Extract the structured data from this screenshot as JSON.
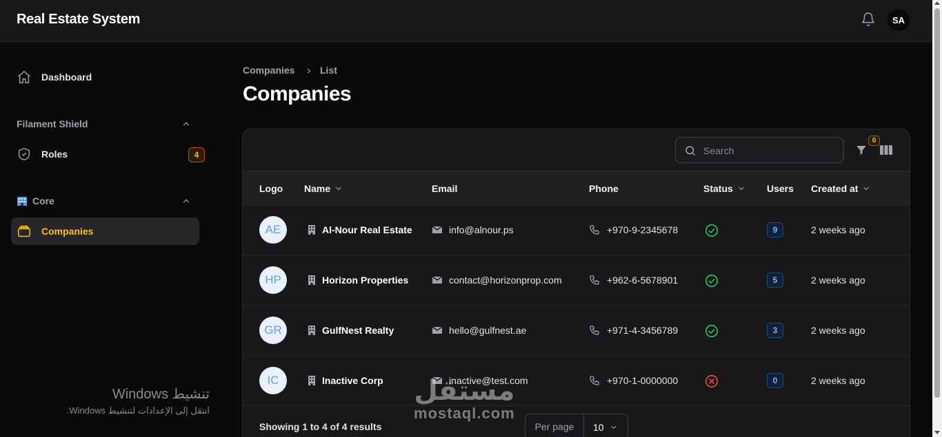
{
  "app": {
    "title": "Real Estate System",
    "user_initials": "SA"
  },
  "sidebar": {
    "dashboard": "Dashboard",
    "group_shield": "Filament Shield",
    "roles": {
      "label": "Roles",
      "badge": "4"
    },
    "group_core": "Core",
    "companies": "Companies"
  },
  "breadcrumb": {
    "root": "Companies",
    "current": "List"
  },
  "page_title": "Companies",
  "table": {
    "search_placeholder": "Search",
    "filter_count": "0",
    "columns": [
      "Logo",
      "Name",
      "Email",
      "Phone",
      "Status",
      "Users",
      "Created at"
    ],
    "rows": [
      {
        "initials": "AE",
        "name": "Al-Nour Real Estate",
        "email": "info@alnour.ps",
        "phone": "+970-9-2345678",
        "status": "active",
        "users": "9",
        "created": "2 weeks ago"
      },
      {
        "initials": "HP",
        "name": "Horizon Properties",
        "email": "contact@horizonprop.com",
        "phone": "+962-6-5678901",
        "status": "active",
        "users": "5",
        "created": "2 weeks ago"
      },
      {
        "initials": "GR",
        "name": "GulfNest Realty",
        "email": "hello@gulfnest.ae",
        "phone": "+971-4-3456789",
        "status": "active",
        "users": "3",
        "created": "2 weeks ago"
      },
      {
        "initials": "IC",
        "name": "Inactive Corp",
        "email": "inactive@test.com",
        "phone": "+970-1-0000000",
        "status": "inactive",
        "users": "0",
        "created": "2 weeks ago"
      }
    ],
    "footer": "Showing 1 to 4 of 4 results",
    "per_page_label": "Per page",
    "per_page_value": "10"
  },
  "overlay": {
    "windows_line1": "تنشيط Windows",
    "windows_line2": "انتقل إلى الإعدادات لتنشيط Windows.",
    "watermark_ar": "مستقل",
    "watermark_en": "mostaql.com"
  },
  "colors": {
    "accent": "#fbbf24",
    "success": "#22c55e",
    "danger": "#ef4444",
    "info": "#7cb3f5"
  }
}
